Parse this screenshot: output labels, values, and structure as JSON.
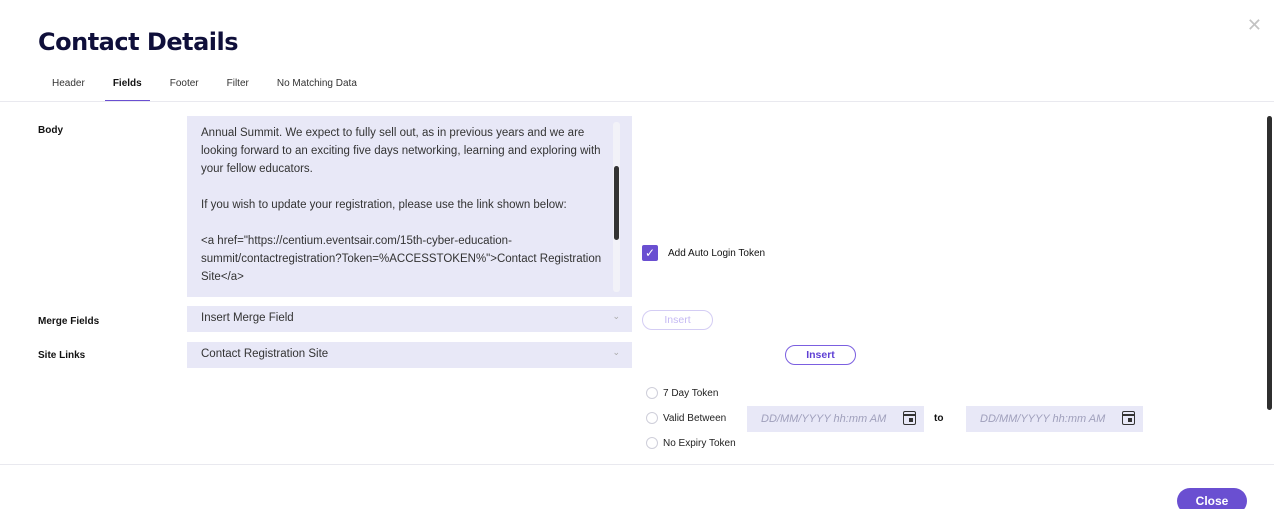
{
  "dialog": {
    "title": "Contact Details",
    "close_icon": "close-icon"
  },
  "tabs": [
    {
      "label": "Header",
      "active": false
    },
    {
      "label": "Fields",
      "active": true
    },
    {
      "label": "Footer",
      "active": false
    },
    {
      "label": "Filter",
      "active": false
    },
    {
      "label": "No Matching Data",
      "active": false
    }
  ],
  "fields": {
    "body_label": "Body",
    "body_paragraphs": [
      "Annual Summit.  We expect to fully sell out, as in previous years and we are looking forward to an exciting five days networking, learning and exploring with your fellow educators.",
      "If you wish to update your registration, please use the link shown below:",
      "<a href=\"https://centium.eventsair.com/15th-cyber-education-summit/contactregistration?Token=%ACCESSTOKEN%\">Contact Registration Site</a>"
    ],
    "merge_fields_label": "Merge Fields",
    "merge_field_value": "Insert Merge Field",
    "merge_insert_label": "Insert",
    "site_links_label": "Site Links",
    "site_link_value": "Contact Registration Site",
    "auto_login_label": "Add Auto Login Token",
    "auto_login_checked": true,
    "site_insert_label": "Insert",
    "token_options": {
      "seven_day": "7 Day Token",
      "valid_between": "Valid Between",
      "no_expiry": "No Expiry Token"
    },
    "date_from_placeholder": "DD/MM/YYYY hh:mm AM",
    "to_label": "to",
    "date_to_placeholder": "DD/MM/YYYY hh:mm AM"
  },
  "footer": {
    "close_label": "Close"
  },
  "colors": {
    "accent": "#6a4fd1",
    "field_bg": "#e8e8f7",
    "title": "#0f0f3a"
  }
}
